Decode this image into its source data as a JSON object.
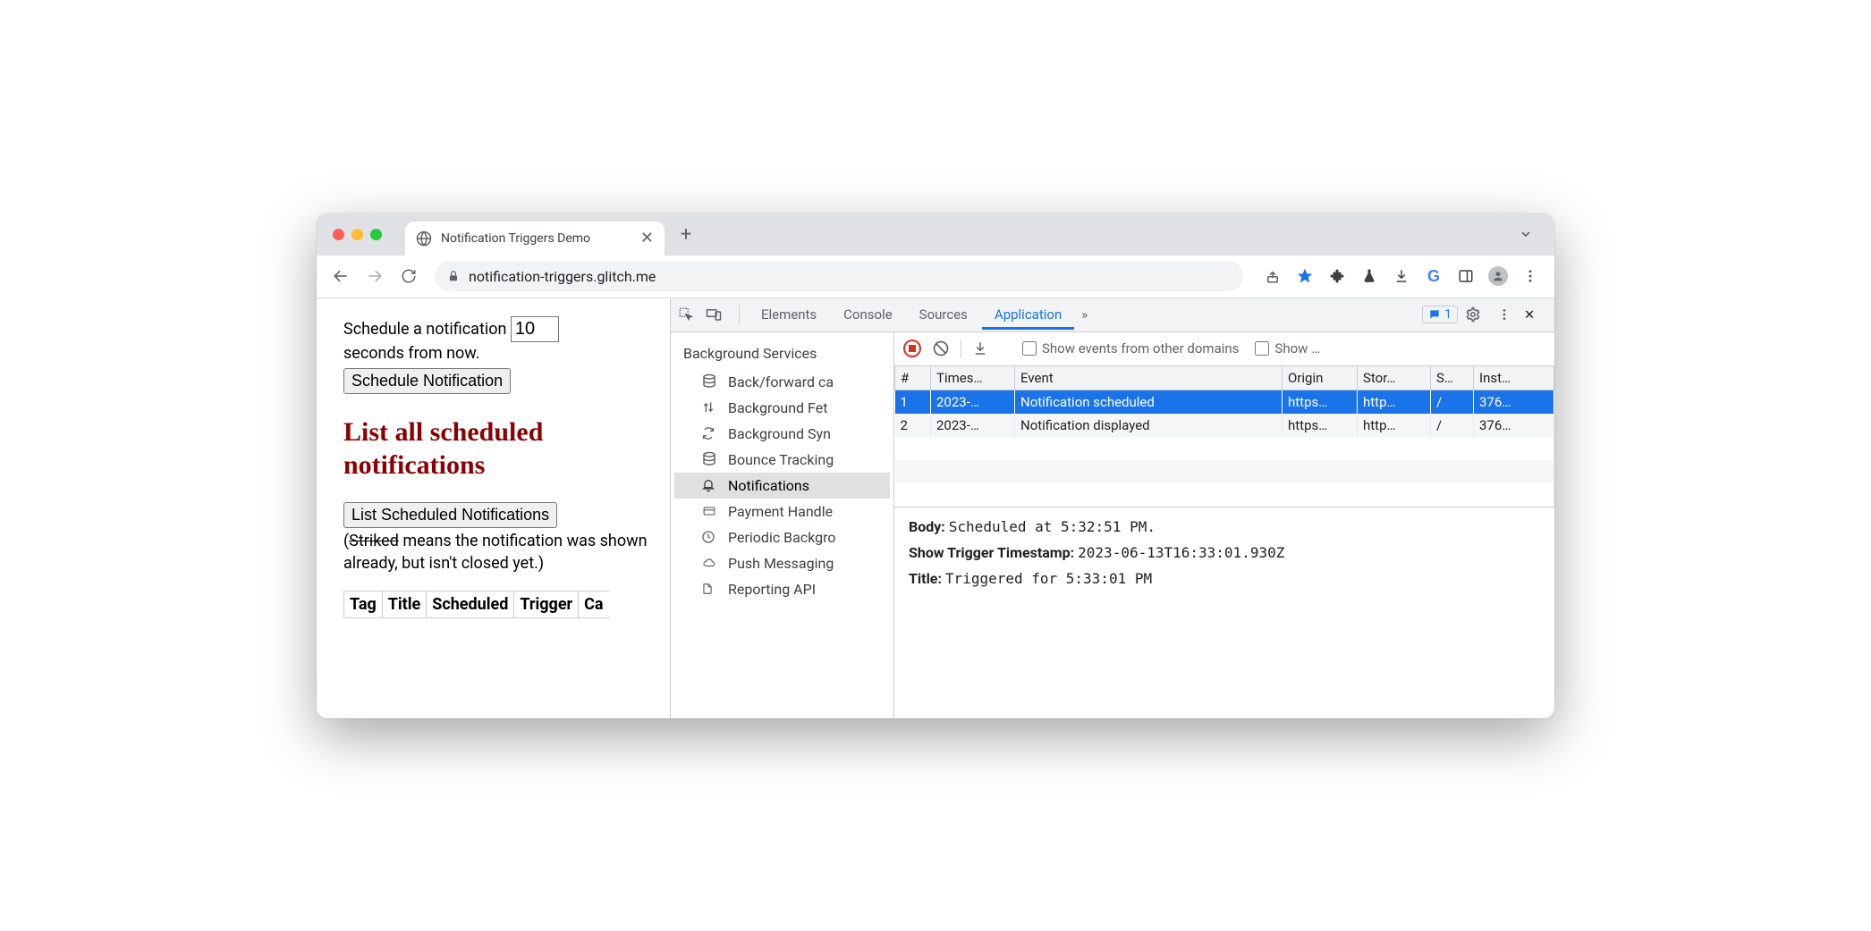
{
  "tab": {
    "title": "Notification Triggers Demo"
  },
  "omnibox": {
    "url": "notification-triggers.glitch.me"
  },
  "page": {
    "schedule_pre": "Schedule a notification",
    "schedule_value": "10",
    "schedule_post": "seconds from now.",
    "schedule_button": "Schedule Notification",
    "heading": "List all scheduled notifications",
    "list_button": "List Scheduled Notifications",
    "hint_open": "(",
    "hint_striked": "Striked",
    "hint_rest": " means the notification was shown already, but isn't closed yet.)",
    "cols": [
      "Tag",
      "Title",
      "Scheduled",
      "Trigger",
      "Ca"
    ]
  },
  "devtools": {
    "tabs": [
      "Elements",
      "Console",
      "Sources",
      "Application"
    ],
    "more": "»",
    "issues_count": "1",
    "sidebar_heading": "Background Services",
    "sidebar": [
      {
        "icon": "db",
        "label": "Back/forward ca"
      },
      {
        "icon": "updown",
        "label": "Background Fet"
      },
      {
        "icon": "sync",
        "label": "Background Syn"
      },
      {
        "icon": "db",
        "label": "Bounce Tracking"
      },
      {
        "icon": "bell",
        "label": "Notifications"
      },
      {
        "icon": "card",
        "label": "Payment Handle"
      },
      {
        "icon": "clock",
        "label": "Periodic Backgro"
      },
      {
        "icon": "cloud",
        "label": "Push Messaging"
      },
      {
        "icon": "file",
        "label": "Reporting API"
      }
    ],
    "events_toolbar": {
      "show_domains": "Show events from other domains",
      "show_more": "Show …"
    },
    "columns": [
      "#",
      "Times…",
      "Event",
      "Origin",
      "Stor…",
      "S…",
      "Inst…"
    ],
    "rows": [
      {
        "num": "1",
        "ts": "2023-…",
        "event": "Notification scheduled",
        "origin": "https…",
        "storage": "http…",
        "s": "/",
        "inst": "376…"
      },
      {
        "num": "2",
        "ts": "2023-…",
        "event": "Notification displayed",
        "origin": "https…",
        "storage": "http…",
        "s": "/",
        "inst": "376…"
      }
    ],
    "details": {
      "body_label": "Body:",
      "body_value": "Scheduled at 5:32:51 PM.",
      "trigger_label": "Show Trigger Timestamp:",
      "trigger_value": "2023-06-13T16:33:01.930Z",
      "title_label": "Title:",
      "title_value": "Triggered for 5:33:01 PM"
    }
  }
}
